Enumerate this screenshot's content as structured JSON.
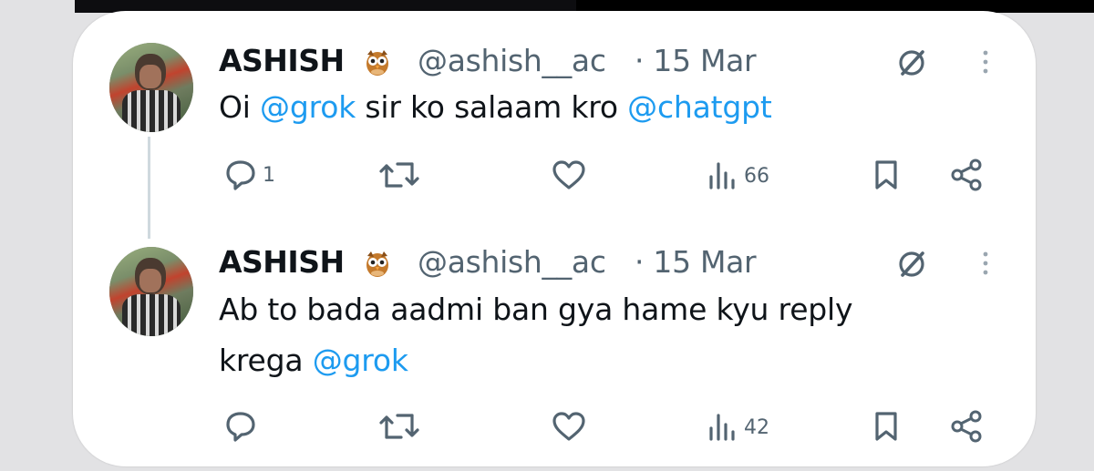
{
  "tweets": [
    {
      "author": {
        "name": "ASHISH",
        "handle": "@ashish__ac",
        "badge": "owl-emoji"
      },
      "date": "· 15 Mar",
      "text": {
        "t1": "Oi ",
        "m1": "@grok",
        "t2": " sir ko salaam kro ",
        "m2": "@chatgpt"
      },
      "stats": {
        "replies": "1",
        "reposts": "",
        "likes": "",
        "views": "66"
      }
    },
    {
      "author": {
        "name": "ASHISH",
        "handle": "@ashish__ac",
        "badge": "owl-emoji"
      },
      "date": "· 15 Mar",
      "text": {
        "line1": "Ab to bada aadmi ban gya hame kyu reply",
        "t2": "krega ",
        "m1": "@grok"
      },
      "stats": {
        "replies": "",
        "reposts": "",
        "likes": "",
        "views": "42"
      }
    }
  ],
  "colors": {
    "mention": "#1d9bf0",
    "muted": "#536471",
    "text": "#0f1419"
  },
  "icons": [
    "reply-icon",
    "repost-icon",
    "like-icon",
    "views-icon",
    "bookmark-icon",
    "share-icon",
    "grok-icon",
    "more-icon"
  ]
}
